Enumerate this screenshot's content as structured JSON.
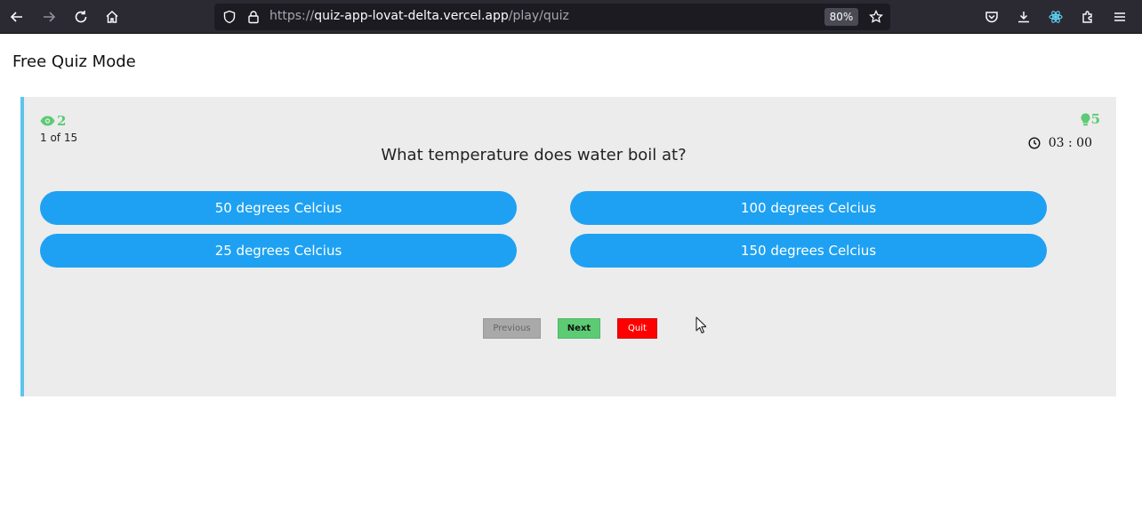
{
  "browser": {
    "url_prefix": "https://",
    "url_domain": "quiz-app-lovat-delta.vercel.app",
    "url_path": "/play/quiz",
    "zoom": "80%"
  },
  "page": {
    "title": "Free Quiz Mode"
  },
  "quiz": {
    "hints_remaining": "2",
    "fifty_fifty_remaining": "5",
    "progress": "1 of 15",
    "timer": "03 : 00",
    "question": "What temperature does water boil at?",
    "options": [
      "50 degrees Celcius",
      "100 degrees Celcius",
      "25 degrees Celcius",
      "150 degrees Celcius"
    ],
    "buttons": {
      "previous": "Previous",
      "next": "Next",
      "quit": "Quit"
    }
  },
  "colors": {
    "accent_blue": "#1ea1f2",
    "card_border": "#5bc5ec",
    "green": "#5ccb74",
    "quit_red": "#ff0000"
  }
}
